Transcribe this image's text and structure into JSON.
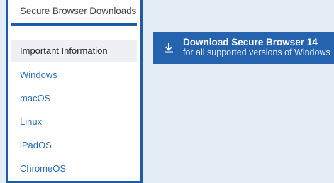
{
  "sidebar": {
    "header": "Secure Browser Downloads",
    "items": [
      {
        "label": "Important Information"
      },
      {
        "label": "Windows"
      },
      {
        "label": "macOS"
      },
      {
        "label": "Linux"
      },
      {
        "label": "iPadOS"
      },
      {
        "label": "ChromeOS"
      }
    ]
  },
  "download": {
    "title": "Download Secure Browser 14",
    "subtitle": "for all supported versions of Windows",
    "icon": "download-icon"
  },
  "colors": {
    "background": "#e4ecf5",
    "accent": "#1f5ca8",
    "button": "#2563af",
    "link": "#2a6fb8"
  }
}
